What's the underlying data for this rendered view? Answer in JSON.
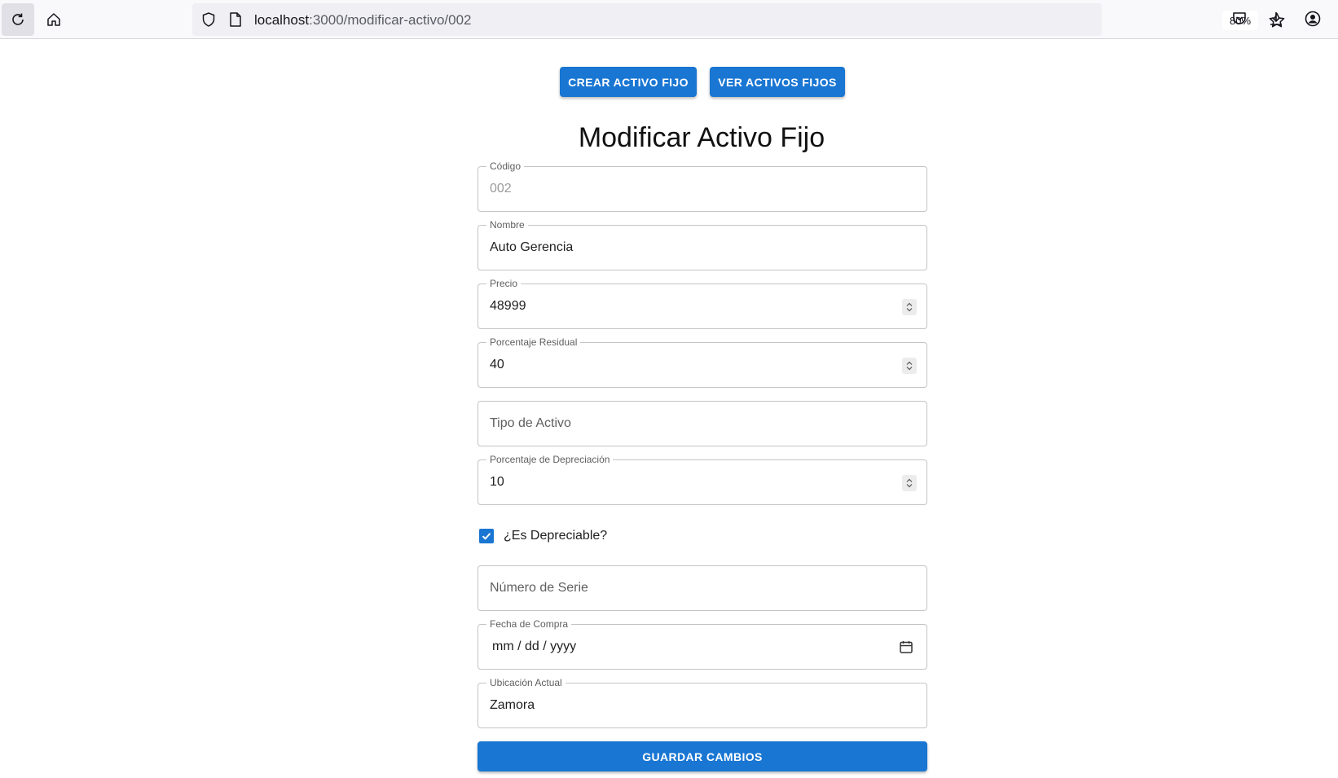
{
  "browser": {
    "url_host": "localhost",
    "url_path": ":3000/modificar-activo/002",
    "zoom": "80%"
  },
  "actions": {
    "create_label": "CREAR ACTIVO FIJO",
    "view_label": "VER ACTIVOS FIJOS"
  },
  "form": {
    "title": "Modificar Activo Fijo",
    "codigo": {
      "label": "Código",
      "value": "002"
    },
    "nombre": {
      "label": "Nombre",
      "value": "Auto Gerencia"
    },
    "precio": {
      "label": "Precio",
      "value": "48999"
    },
    "porcentaje_residual": {
      "label": "Porcentaje Residual",
      "value": "40"
    },
    "tipo_activo": {
      "placeholder": "Tipo de Activo"
    },
    "porcentaje_depreciacion": {
      "label": "Porcentaje de Depreciación",
      "value": "10"
    },
    "es_depreciable": {
      "label": "¿Es Depreciable?",
      "checked": true
    },
    "numero_serie": {
      "placeholder": "Número de Serie"
    },
    "fecha_compra": {
      "label": "Fecha de Compra",
      "value": "mm / dd / yyyy"
    },
    "ubicacion_actual": {
      "label": "Ubicación Actual",
      "value": "Zamora"
    },
    "save_label": "GUARDAR CAMBIOS"
  },
  "colors": {
    "primary": "#1976d2",
    "border": "#c4c4c4"
  }
}
